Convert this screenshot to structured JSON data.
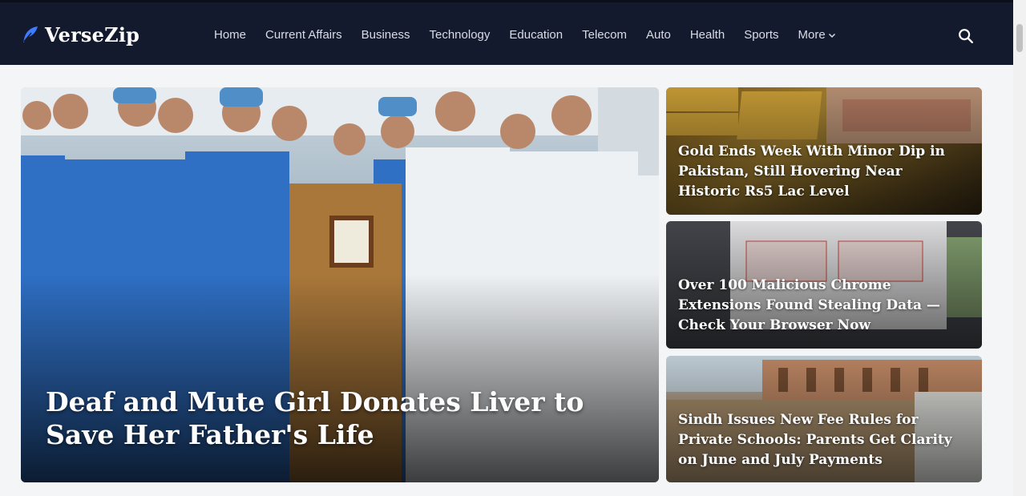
{
  "header": {
    "brand": "VerseZip",
    "nav": [
      {
        "label": "Home"
      },
      {
        "label": "Current Affairs"
      },
      {
        "label": "Business"
      },
      {
        "label": "Technology"
      },
      {
        "label": "Education"
      },
      {
        "label": "Telecom"
      },
      {
        "label": "Auto"
      },
      {
        "label": "Health"
      },
      {
        "label": "Sports"
      }
    ],
    "more_label": "More",
    "icons": {
      "logo": "feather-icon",
      "search": "search-icon",
      "more": "chevron-down-icon"
    },
    "colors": {
      "background": "#141a2e",
      "accent": "#3d7bff"
    }
  },
  "main": {
    "featured": {
      "title": "Deaf and Mute Girl Donates Liver to Save Her Father's Life"
    },
    "side_stories": [
      {
        "title": "Gold Ends Week With Minor Dip in Pakistan, Still Hovering Near Historic Rs5 Lac Level"
      },
      {
        "title": "Over 100 Malicious Chrome Extensions Found Stealing Data — Check Your Browser Now"
      },
      {
        "title": "Sindh Issues New Fee Rules for Private Schools: Parents Get Clarity on June and July Payments"
      }
    ]
  }
}
